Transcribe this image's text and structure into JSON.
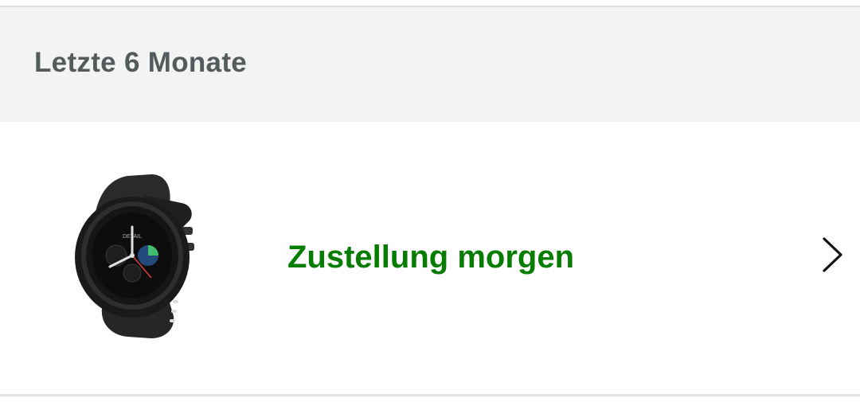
{
  "section": {
    "title": "Letzte 6 Monate"
  },
  "order": {
    "product_icon": "smartwatch-image",
    "delivery_status": "Zustellung morgen",
    "status_color": "#067d00",
    "chevron_icon": "chevron-right-icon"
  },
  "colors": {
    "header_bg": "#f3f3f3",
    "header_text": "#545b5d",
    "status_green": "#067d00"
  }
}
